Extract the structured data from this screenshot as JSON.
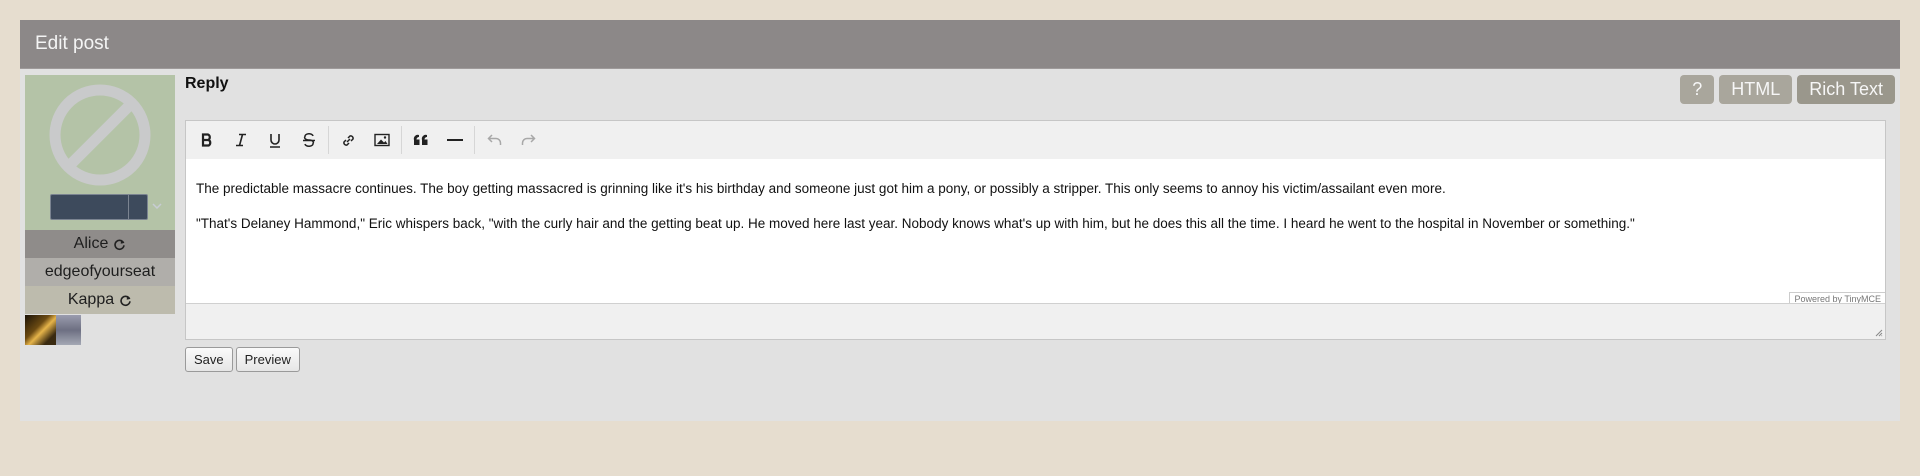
{
  "panel": {
    "title": "Edit post"
  },
  "profile": {
    "names": [
      {
        "label": "Alice",
        "refresh_icon": "refresh-icon"
      },
      {
        "label": "edgeofyourseat"
      },
      {
        "label": "Kappa",
        "refresh_icon": "refresh-icon"
      }
    ],
    "avatar_icon": "no-avatar-icon",
    "character_select": {
      "value": ""
    }
  },
  "reply": {
    "label": "Reply",
    "mode_buttons": {
      "help": "?",
      "html": "HTML",
      "rich_text": "Rich Text"
    }
  },
  "editor": {
    "toolbar": [
      "bold-icon",
      "italic-icon",
      "underline-icon",
      "strikethrough-icon",
      "link-icon",
      "image-icon",
      "blockquote-icon",
      "horizontal-rule-icon",
      "undo-icon",
      "redo-icon"
    ],
    "paragraphs": [
      "The predictable massacre continues. The boy getting massacred is grinning like it's his birthday and someone just got him a pony, or possibly a stripper. This only seems to annoy his victim/assailant even more.",
      "\"That's Delaney Hammond,\" Eric whispers back, \"with the curly hair and the getting beat up. He moved here last year. Nobody knows what's up with him, but he does this all the time. I heard he went to the hospital in November or something.\""
    ],
    "powered_by": "Powered by TinyMCE"
  },
  "form": {
    "save_label": "Save",
    "preview_label": "Preview"
  }
}
